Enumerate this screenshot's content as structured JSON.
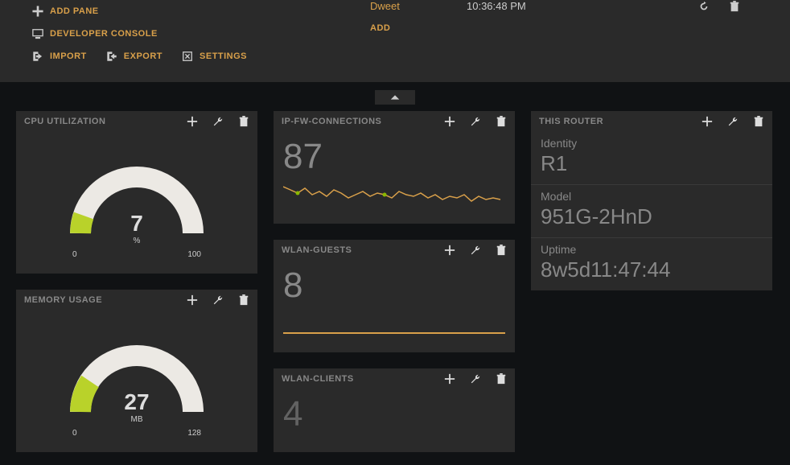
{
  "toolbar": {
    "add_pane": "ADD PANE",
    "developer_console": "DEVELOPER CONSOLE",
    "import": "IMPORT",
    "export": "EXPORT",
    "settings": "SETTINGS"
  },
  "datasources": {
    "rows": [
      {
        "name": "Dweet",
        "time": "10:36:48 PM"
      }
    ],
    "add_label": "ADD"
  },
  "panels": {
    "cpu": {
      "title": "CPU UTILIZATION",
      "value": "7",
      "unit": "%",
      "min": "0",
      "max": "100"
    },
    "memory": {
      "title": "MEMORY USAGE",
      "value": "27",
      "unit": "MB",
      "min": "0",
      "max": "128"
    },
    "ipfw": {
      "title": "IP-FW-CONNECTIONS",
      "value": "87"
    },
    "wlan_guests": {
      "title": "WLAN-GUESTS",
      "value": "8"
    },
    "wlan_clients": {
      "title": "WLAN-CLIENTS",
      "value": "4"
    },
    "router": {
      "title": "THIS ROUTER",
      "identity_label": "Identity",
      "identity_value": "R1",
      "model_label": "Model",
      "model_value": "951G-2HnD",
      "uptime_label": "Uptime",
      "uptime_value": "8w5d11:47:44"
    }
  },
  "chart_data": [
    {
      "type": "gauge",
      "title": "CPU UTILIZATION",
      "value": 7,
      "min": 0,
      "max": 100,
      "unit": "%"
    },
    {
      "type": "gauge",
      "title": "MEMORY USAGE",
      "value": 27,
      "min": 0,
      "max": 128,
      "unit": "MB"
    },
    {
      "type": "line",
      "title": "IP-FW-CONNECTIONS",
      "current": 87,
      "values": [
        92,
        90,
        88,
        91,
        87,
        89,
        86,
        90,
        88,
        85,
        87,
        89,
        86,
        88,
        87,
        85,
        89,
        87,
        86,
        88,
        85,
        87,
        84,
        86,
        85,
        87,
        83,
        86,
        84,
        85
      ],
      "ylim": [
        80,
        95
      ]
    },
    {
      "type": "line",
      "title": "WLAN-GUESTS",
      "current": 8,
      "values": [
        8,
        8,
        8,
        8,
        8,
        8,
        8,
        8,
        8,
        8,
        8,
        8,
        8,
        8,
        8,
        8,
        8,
        8,
        8,
        8
      ]
    },
    {
      "type": "text",
      "title": "WLAN-CLIENTS",
      "current": 4
    }
  ]
}
